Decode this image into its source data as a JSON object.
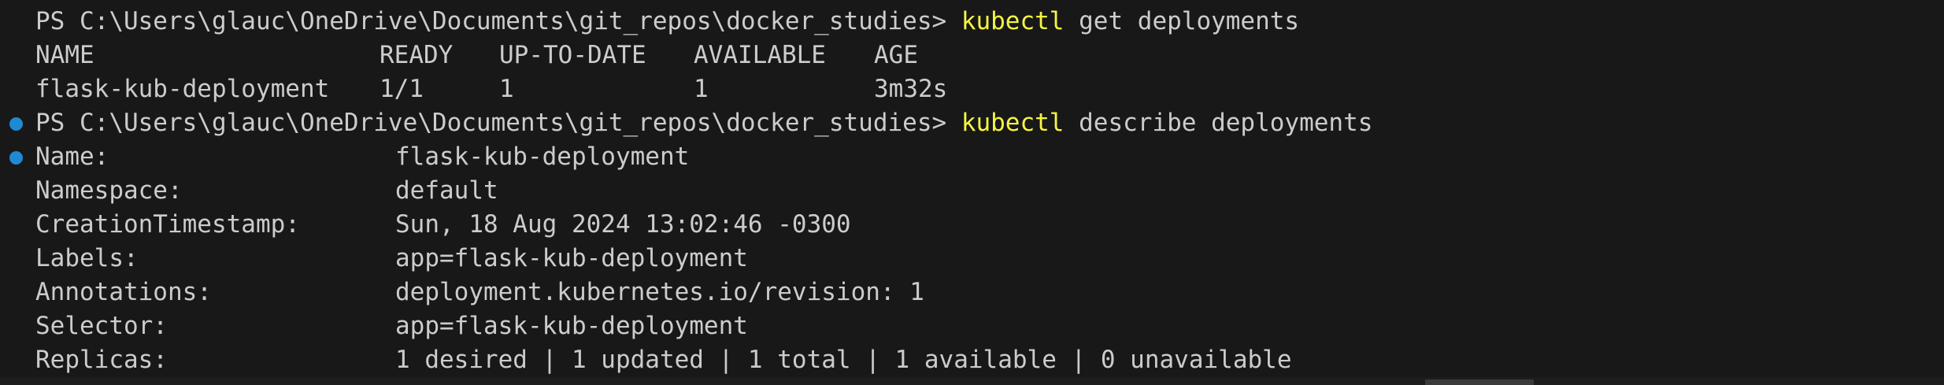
{
  "prompt": "PS C:\\Users\\glauc\\OneDrive\\Documents\\git_repos\\docker_studies> ",
  "commands": [
    {
      "keyword": "kubectl",
      "args": " get deployments"
    },
    {
      "keyword": "kubectl",
      "args": " describe deployments"
    }
  ],
  "table": {
    "headers": [
      "NAME",
      "READY",
      "UP-TO-DATE",
      "AVAILABLE",
      "AGE"
    ],
    "rows": [
      [
        "flask-kub-deployment",
        "1/1",
        "1",
        "1",
        "3m32s"
      ]
    ]
  },
  "describe": [
    {
      "key": "Name:",
      "value": "flask-kub-deployment"
    },
    {
      "key": "Namespace:",
      "value": "default"
    },
    {
      "key": "CreationTimestamp:",
      "value": "Sun, 18 Aug 2024 13:02:46 -0300"
    },
    {
      "key": "Labels:",
      "value": "app=flask-kub-deployment"
    },
    {
      "key": "Annotations:",
      "value": "deployment.kubernetes.io/revision: 1"
    },
    {
      "key": "Selector:",
      "value": "app=flask-kub-deployment"
    },
    {
      "key": "Replicas:",
      "value": "1 desired | 1 updated | 1 total | 1 available | 0 unavailable"
    }
  ],
  "colors": {
    "background": "#181818",
    "text": "#cccccc",
    "command_keyword": "#f5f543",
    "decoration_dot": "#1f8ad2"
  }
}
